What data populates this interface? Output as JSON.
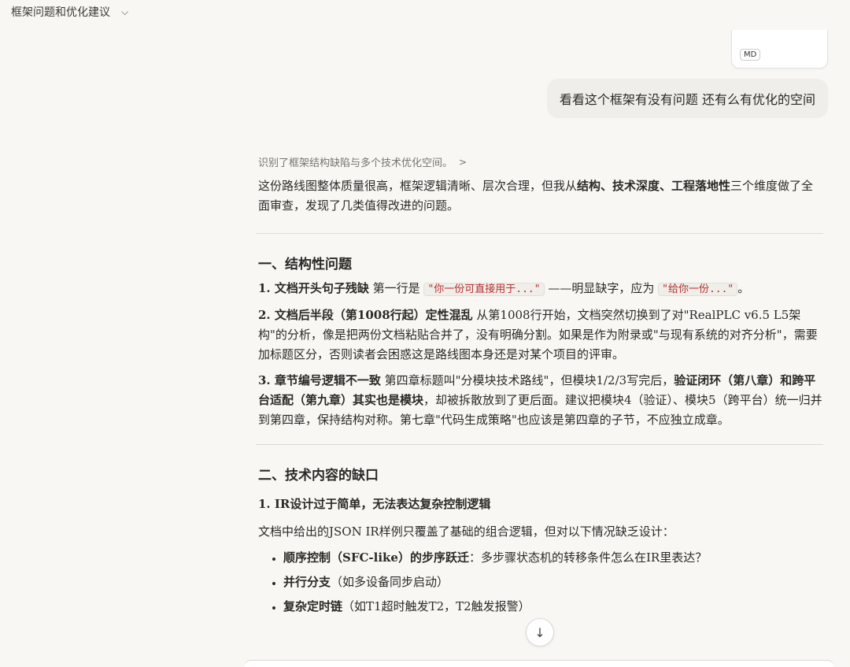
{
  "header": {
    "title": "框架问题和优化建议"
  },
  "attachment": {
    "badge": "MD"
  },
  "user_message": "看看这个框架有没有问题 还有么有优化的空间",
  "thinking": {
    "summary": "识别了框架结构缺陷与多个技术优化空间。"
  },
  "intro": {
    "t1": "这份路线图整体质量很高，框架逻辑清晰、层次合理，但我从",
    "bold": "结构、技术深度、工程落地性",
    "t2": "三个维度做了全面审查，发现了几类值得改进的问题。"
  },
  "section1": {
    "heading": "一、结构性问题",
    "item1": {
      "title": "1. 文档开头句子残缺",
      "t1": " 第一行是 ",
      "code1": "\"你一份可直接用于...\"",
      "t2": " ——明显缺字，应为 ",
      "code2": "\"给你一份...\"",
      "t3": "。"
    },
    "item2": {
      "title": "2. 文档后半段（第1008行起）定性混乱",
      "text": " 从第1008行开始，文档突然切换到了对\"RealPLC v6.5 L5架构\"的分析，像是把两份文档粘贴合并了，没有明确分割。如果是作为附录或\"与现有系统的对齐分析\"，需要加标题区分，否则读者会困惑这是路线图本身还是对某个项目的评审。"
    },
    "item3": {
      "title": "3. 章节编号逻辑不一致",
      "t1": " 第四章标题叫\"分模块技术路线\"，但模块1/2/3写完后，",
      "bold": "验证闭环（第八章）和跨平台适配（第九章）其实也是模块",
      "t2": "，却被拆散放到了更后面。建议把模块4（验证）、模块5（跨平台）统一归并到第四章，保持结构对称。第七章\"代码生成策略\"也应该是第四章的子节，不应独立成章。"
    }
  },
  "section2": {
    "heading": "二、技术内容的缺口",
    "sub1": "1. IR设计过于简单，无法表达复杂控制逻辑",
    "doc_line": "文档中给出的JSON IR样例只覆盖了基础的组合逻辑，但对以下情况缺乏设计：",
    "bullets": [
      {
        "bold": "顺序控制（SFC-like）的步序跃迁",
        "text": "：多步骤状态机的转移条件怎么在IR里表达？"
      },
      {
        "bold": "并行分支",
        "text": "（如多设备同步启动）"
      },
      {
        "bold": "复杂定时链",
        "text": "（如T1超时触发T2，T2触发报警）"
      }
    ]
  },
  "scroll_button": {
    "icon": "↓"
  }
}
